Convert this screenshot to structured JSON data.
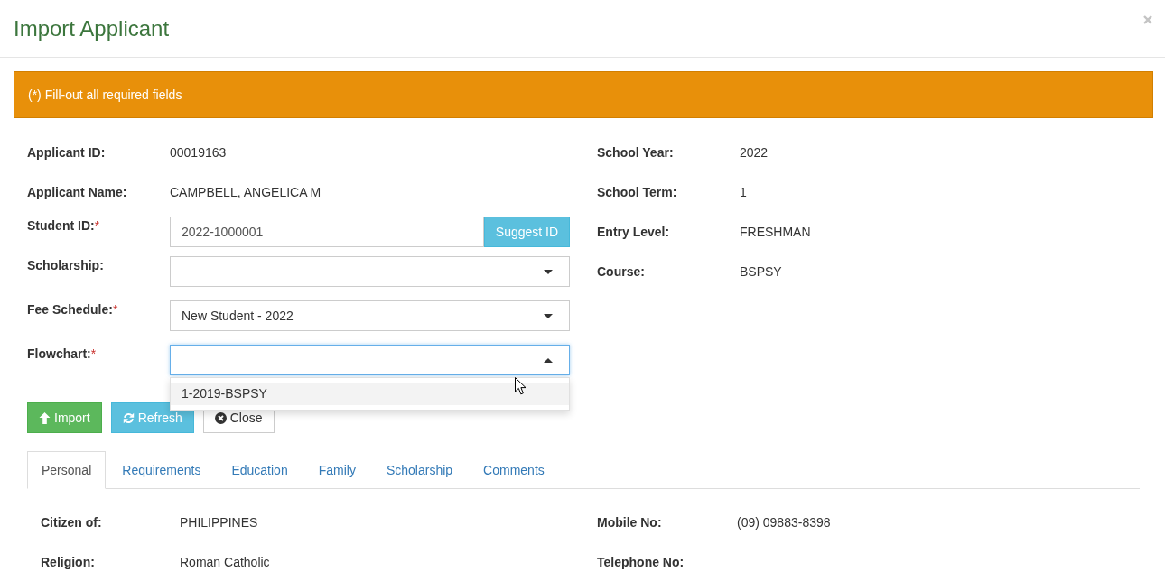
{
  "dialog": {
    "title": "Import Applicant"
  },
  "alert": {
    "text": "(*) Fill-out all required fields"
  },
  "applicant_info": [
    {
      "label": "Applicant ID:",
      "value": "00019163"
    },
    {
      "label": "Applicant Name:",
      "value": "CAMPBELL, ANGELICA M"
    }
  ],
  "form_fields": [
    {
      "kind": "text",
      "label": "Student ID:",
      "required_mark": "*",
      "value": "2022-1000001",
      "focused": false,
      "addon_button": "Suggest ID"
    },
    {
      "kind": "select",
      "label": "Scholarship:",
      "focused": false,
      "expanded": false
    },
    {
      "kind": "select",
      "label": "Fee Schedule:",
      "required_mark": "*",
      "value": "New Student - 2022",
      "focused": false,
      "expanded": false
    },
    {
      "kind": "select",
      "label": "Flowchart:",
      "required_mark": "*",
      "focused": true,
      "expanded": true,
      "options": [
        {
          "label": "1-2019-BSPSY",
          "selected": true
        }
      ]
    }
  ],
  "enrollment_info": [
    {
      "label": "School Year:",
      "value": "2022"
    },
    {
      "label": "School Term:",
      "value": "1"
    },
    {
      "label": "Entry Level:",
      "value": "FRESHMAN"
    },
    {
      "label": "Course:",
      "value": "BSPSY"
    }
  ],
  "buttons": [
    {
      "kind": "import",
      "label": "Import"
    },
    {
      "kind": "refresh",
      "label": "Refresh"
    },
    {
      "kind": "close",
      "label": "Close"
    }
  ],
  "tabs": [
    {
      "label": "Personal",
      "selected": true
    },
    {
      "label": "Requirements",
      "selected": false
    },
    {
      "label": "Education",
      "selected": false
    },
    {
      "label": "Family",
      "selected": false
    },
    {
      "label": "Scholarship",
      "selected": false
    },
    {
      "label": "Comments",
      "selected": false
    }
  ],
  "personal_details": {
    "left": [
      {
        "label": "Citizen of:",
        "value": "PHILIPPINES"
      },
      {
        "label": "Religion:",
        "value": "Roman Catholic"
      }
    ],
    "right": [
      {
        "label": "Mobile No:",
        "value": "(09) 09883-8398"
      },
      {
        "label": "Telephone No:"
      }
    ]
  }
}
